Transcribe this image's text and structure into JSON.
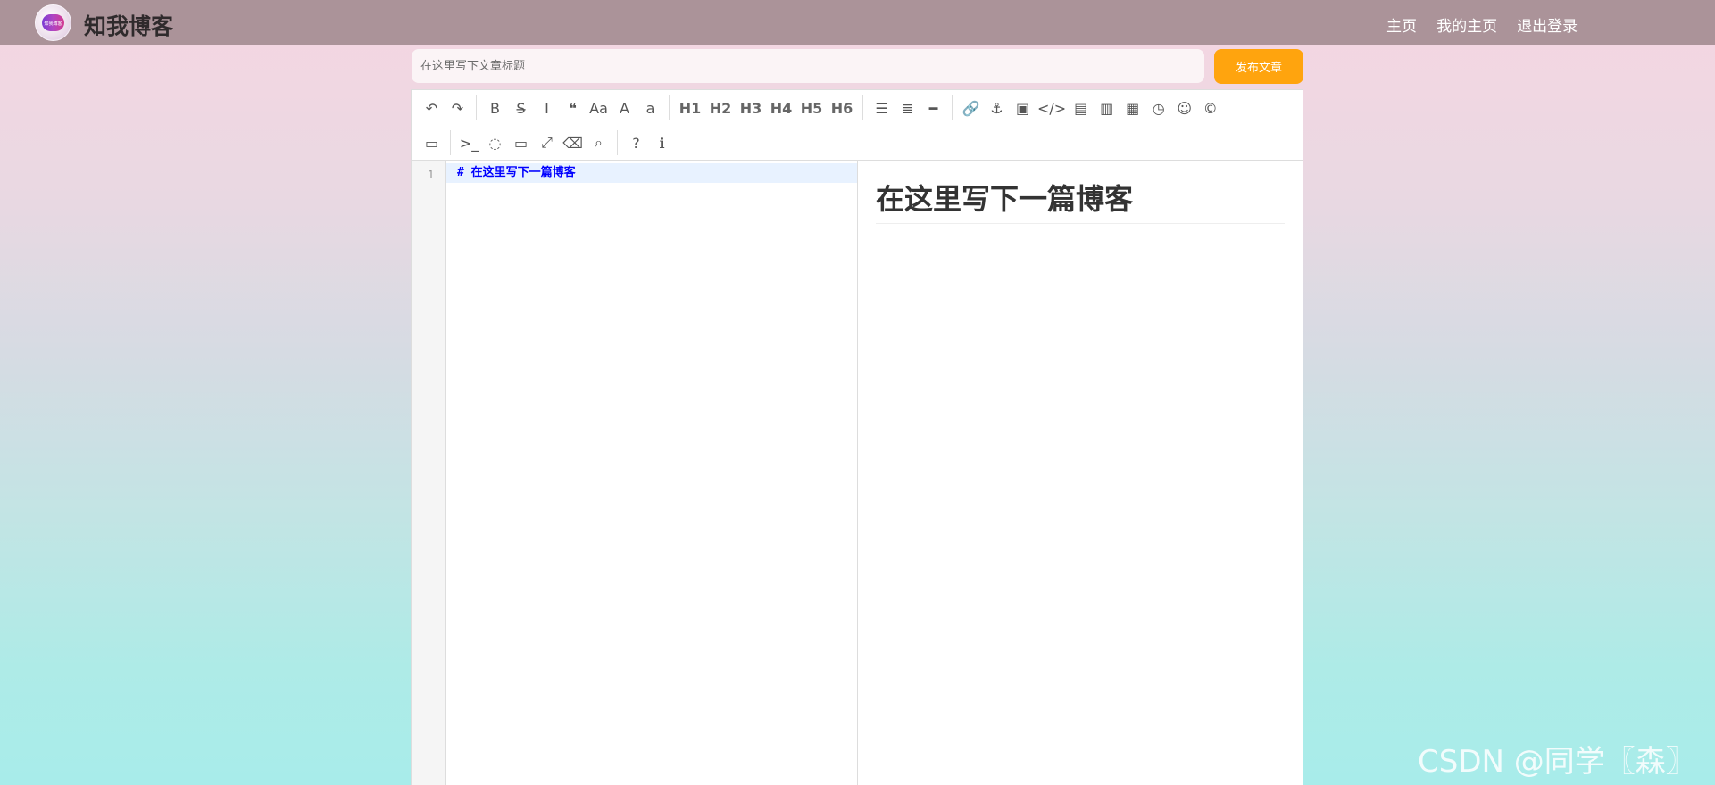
{
  "header": {
    "brand": "知我博客",
    "logo_text": "知我博客",
    "nav": [
      "主页",
      "我的主页",
      "退出登录"
    ]
  },
  "title_input": {
    "placeholder": "在这里写下文章标题",
    "value": ""
  },
  "publish_button": {
    "label": "发布文章"
  },
  "toolbar": {
    "row1": [
      {
        "name": "undo-icon",
        "glyph": "↶"
      },
      {
        "name": "redo-icon",
        "glyph": "↷"
      },
      {
        "sep": true
      },
      {
        "name": "bold-icon",
        "glyph": "B"
      },
      {
        "name": "strikethrough-icon",
        "glyph": "S̶"
      },
      {
        "name": "italic-icon",
        "glyph": "I"
      },
      {
        "name": "quote-icon",
        "glyph": "❝"
      },
      {
        "name": "uppercase-icon",
        "glyph": "Aa"
      },
      {
        "name": "uppercase-letter-icon",
        "glyph": "A"
      },
      {
        "name": "lowercase-icon",
        "glyph": "a"
      },
      {
        "sep": true
      },
      {
        "name": "h1-button",
        "glyph": "H1",
        "txt": true
      },
      {
        "name": "h2-button",
        "glyph": "H2",
        "txt": true
      },
      {
        "name": "h3-button",
        "glyph": "H3",
        "txt": true
      },
      {
        "name": "h4-button",
        "glyph": "H4",
        "txt": true
      },
      {
        "name": "h5-button",
        "glyph": "H5",
        "txt": true
      },
      {
        "name": "h6-button",
        "glyph": "H6",
        "txt": true
      },
      {
        "sep": true
      },
      {
        "name": "unordered-list-icon",
        "glyph": "☰"
      },
      {
        "name": "ordered-list-icon",
        "glyph": "≣"
      },
      {
        "name": "horizontal-rule-icon",
        "glyph": "━"
      },
      {
        "sep": true
      },
      {
        "name": "link-icon",
        "glyph": "🔗"
      },
      {
        "name": "anchor-icon",
        "glyph": "⚓"
      },
      {
        "name": "image-icon",
        "glyph": "▣"
      },
      {
        "name": "code-icon",
        "glyph": "</>"
      },
      {
        "name": "code-block-icon",
        "glyph": "▤"
      },
      {
        "name": "preformatted-icon",
        "glyph": "▥"
      },
      {
        "name": "table-icon",
        "glyph": "▦"
      },
      {
        "name": "datetime-icon",
        "glyph": "◷"
      },
      {
        "name": "emoji-icon",
        "glyph": "☺"
      },
      {
        "name": "html-entities-icon",
        "glyph": "©"
      }
    ],
    "row2": [
      {
        "name": "pagebreak-icon",
        "glyph": "▭"
      },
      {
        "sep": true
      },
      {
        "name": "goto-line-icon",
        "glyph": ">_"
      },
      {
        "name": "watch-toggle-icon",
        "glyph": "◌"
      },
      {
        "name": "preview-icon",
        "glyph": "▭"
      },
      {
        "name": "fullscreen-icon",
        "glyph": "⤢"
      },
      {
        "name": "clear-icon",
        "glyph": "⌫"
      },
      {
        "name": "search-icon",
        "glyph": "⌕"
      },
      {
        "sep": true
      },
      {
        "name": "help-icon",
        "glyph": "?"
      },
      {
        "name": "info-icon",
        "glyph": "ℹ"
      }
    ]
  },
  "editor": {
    "line_number": "1",
    "code_line": "#  在这里写下一篇博客",
    "preview_heading": "在这里写下一篇博客"
  },
  "watermark": "CSDN @同学〖森〗"
}
